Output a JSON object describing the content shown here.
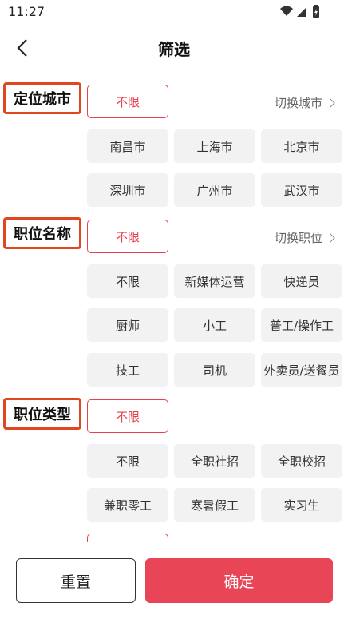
{
  "status_bar": {
    "time": "11:27",
    "icons": [
      "wifi-icon",
      "signal-icon",
      "battery-icon"
    ]
  },
  "header": {
    "title": "筛选",
    "back_icon": "back-chevron-icon"
  },
  "sections": {
    "city": {
      "label": "定位城市",
      "selected": "不限",
      "switch_label": "切换城市",
      "options": [
        "南昌市",
        "上海市",
        "北京市",
        "深圳市",
        "广州市",
        "武汉市"
      ]
    },
    "position": {
      "label": "职位名称",
      "selected": "不限",
      "switch_label": "切换职位",
      "options": [
        "不限",
        "新媒体运营",
        "快递员",
        "厨师",
        "小工",
        "普工/操作工",
        "技工",
        "司机",
        "外卖员/送餐员"
      ]
    },
    "type": {
      "label": "职位类型",
      "selected": "不限",
      "options": [
        "不限",
        "全职社招",
        "全职校招",
        "兼职零工",
        "寒暑假工",
        "实习生"
      ]
    }
  },
  "footer": {
    "reset_label": "重置",
    "confirm_label": "确定"
  },
  "colors": {
    "accent": "#e84656",
    "highlight_border": "#e0471f",
    "chip_bg": "#f2f2f2"
  }
}
